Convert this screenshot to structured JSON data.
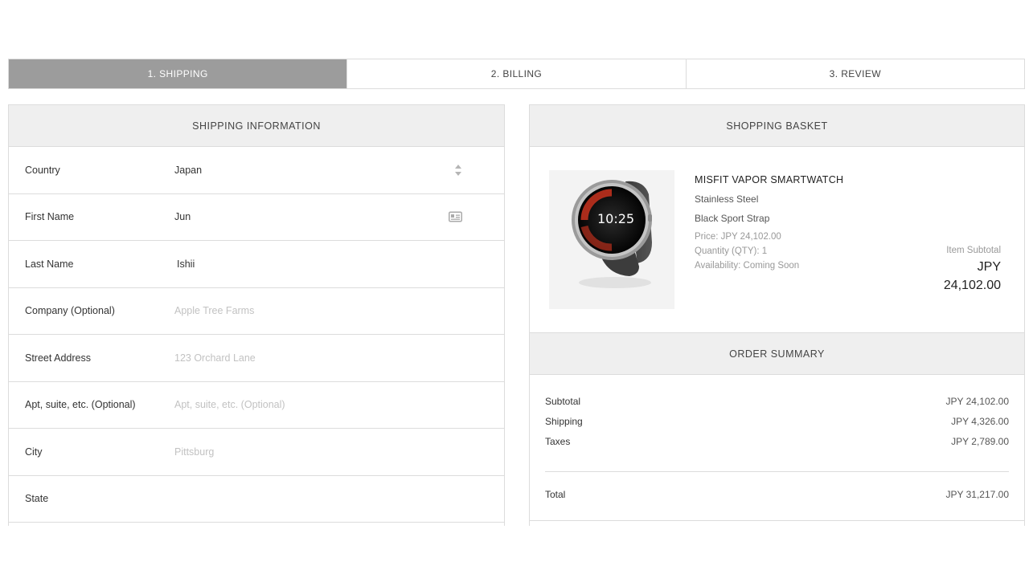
{
  "steps": [
    {
      "label": "1. SHIPPING",
      "active": true
    },
    {
      "label": "2. BILLING",
      "active": false
    },
    {
      "label": "3. REVIEW",
      "active": false
    }
  ],
  "shipping": {
    "header": "SHIPPING INFORMATION",
    "fields": {
      "country": {
        "label": "Country",
        "value": "Japan"
      },
      "first_name": {
        "label": "First Name",
        "value": "Jun"
      },
      "last_name": {
        "label": "Last Name",
        "value": "Ishii"
      },
      "company": {
        "label": "Company (Optional)",
        "placeholder": "Apple Tree Farms"
      },
      "street": {
        "label": "Street Address",
        "placeholder": "123 Orchard Lane"
      },
      "apt": {
        "label": "Apt, suite, etc. (Optional)",
        "placeholder": "Apt, suite, etc. (Optional)"
      },
      "city": {
        "label": "City",
        "placeholder": "Pittsburg"
      },
      "state": {
        "label": "State",
        "value": ""
      }
    }
  },
  "basket": {
    "header": "SHOPPING BASKET",
    "product": {
      "name": "MISFIT VAPOR SMARTWATCH",
      "material": "Stainless Steel",
      "strap": "Black Sport Strap",
      "price": "Price: JPY 24,102.00",
      "quantity": "Quantity (QTY): 1",
      "availability": "Availability: Coming Soon",
      "watch_time": "10:25"
    },
    "item_subtotal_label": "Item Subtotal",
    "item_subtotal_value": "JPY 24,102.00"
  },
  "summary": {
    "header": "ORDER SUMMARY",
    "subtotal_label": "Subtotal",
    "subtotal_value": "JPY 24,102.00",
    "shipping_label": "Shipping",
    "shipping_value": "JPY 4,326.00",
    "taxes_label": "Taxes",
    "taxes_value": "JPY 2,789.00",
    "total_label": "Total",
    "total_value": "JPY 31,217.00"
  },
  "colors": {
    "active_step": "#9c9c9c",
    "header_bg": "#efefef",
    "border": "#dcdcdc",
    "watch_accent": "#c8321e"
  }
}
